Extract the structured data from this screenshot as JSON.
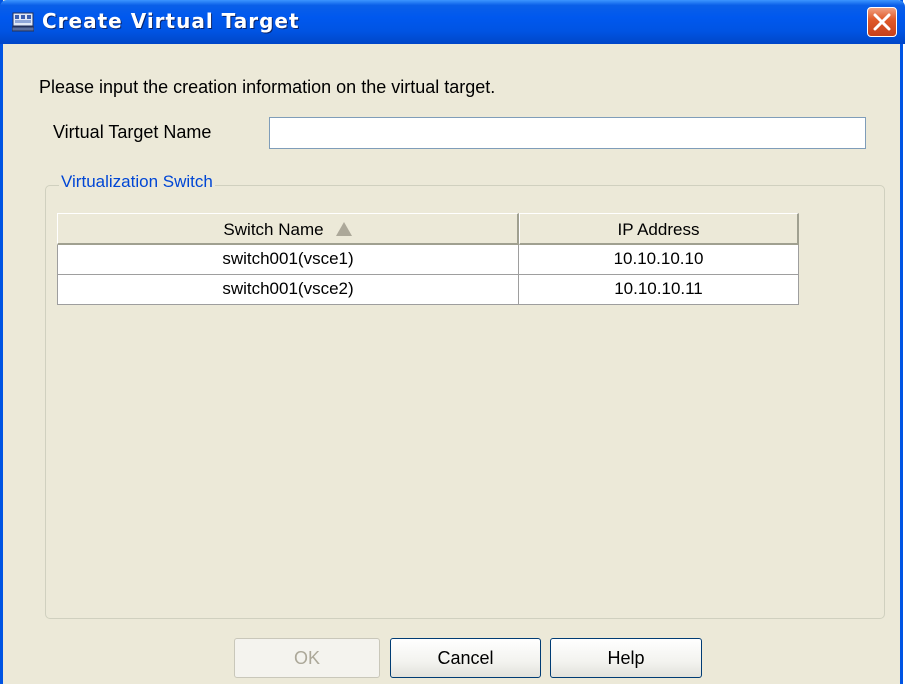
{
  "window": {
    "title": "Create Virtual Target",
    "title_icon": "virtual-target-icon",
    "close_icon": "close-icon"
  },
  "instruction": "Please input the creation information on the virtual target.",
  "virtual_target_name": {
    "label": "Virtual Target Name",
    "value": "",
    "placeholder": ""
  },
  "group": {
    "legend": "Virtualization Switch",
    "table": {
      "columns": [
        "Switch Name",
        "IP Address"
      ],
      "sort": {
        "column": "Switch Name",
        "direction": "ascending",
        "icon": "sort-ascending-icon"
      },
      "rows": [
        {
          "switch_name": "switch001(vsce1)",
          "ip_address": "10.10.10.10"
        },
        {
          "switch_name": "switch001(vsce2)",
          "ip_address": "10.10.10.11"
        }
      ]
    }
  },
  "buttons": {
    "ok": "OK",
    "cancel": "Cancel",
    "help": "Help"
  },
  "colors": {
    "titlebar": "#0054e3",
    "dialog_bg": "#ece9d8",
    "legend_text": "#0046d5",
    "close_button": "#e05a2a"
  }
}
